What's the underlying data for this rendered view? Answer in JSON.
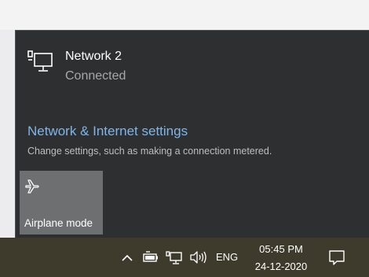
{
  "network": {
    "name": "Network 2",
    "status": "Connected",
    "icon": "ethernet-monitor-icon"
  },
  "settings": {
    "link": "Network & Internet settings",
    "description": "Change settings, such as making a connection metered."
  },
  "quick_actions": [
    {
      "label": "Airplane mode",
      "icon": "airplane-icon"
    }
  ],
  "taskbar": {
    "tray_icons": [
      "chevron-up-icon",
      "battery-icon",
      "network-icon",
      "volume-icon"
    ],
    "language": "ENG",
    "time": "05:45 PM",
    "date": "24-12-2020",
    "notification_icon": "action-center-icon"
  },
  "colors": {
    "flyout_bg": "#2e2f31",
    "link": "#7fb6e9",
    "tile_bg": "#6e6f71",
    "taskbar_bg": "#3e3a2c"
  }
}
